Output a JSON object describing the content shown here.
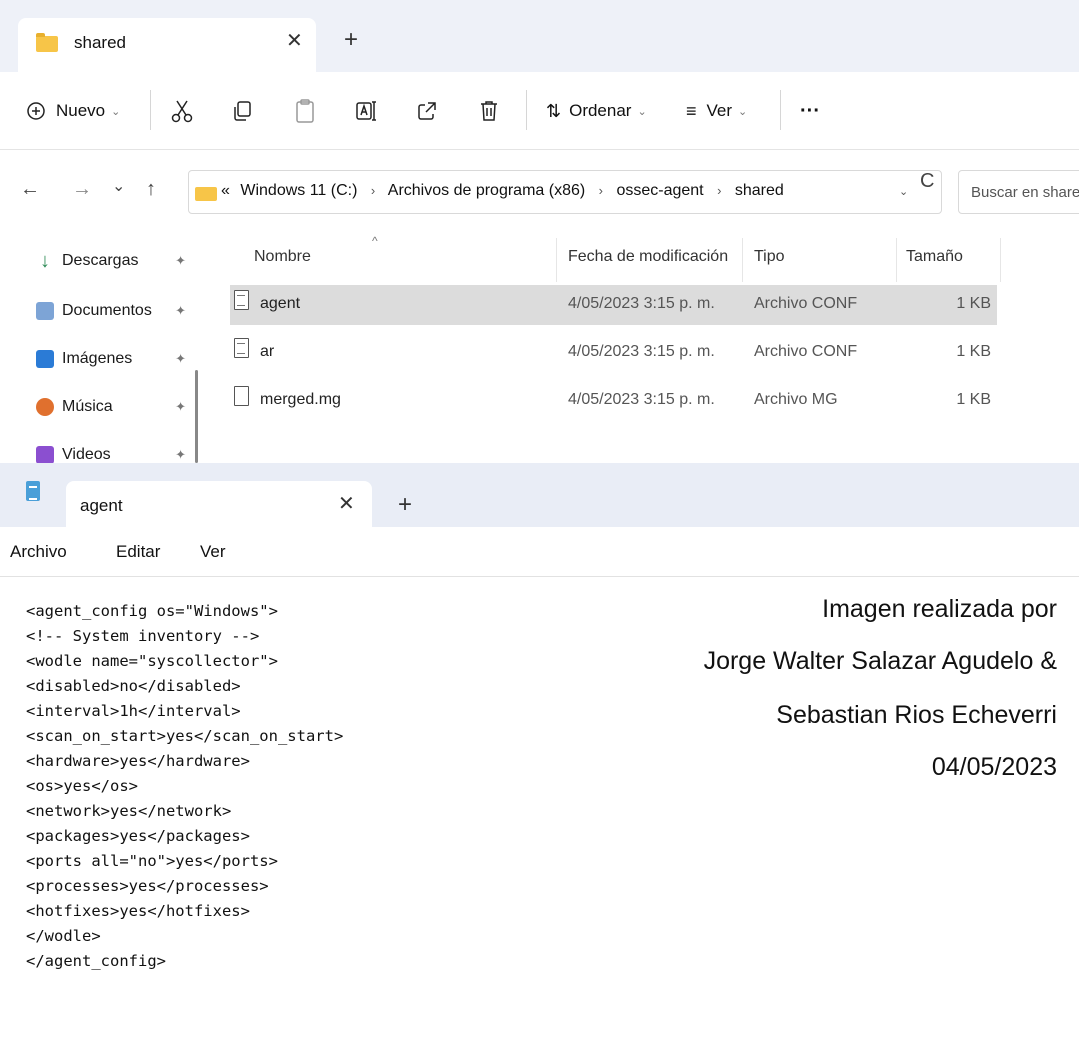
{
  "explorer": {
    "tab": {
      "title": "shared",
      "close": "✕"
    },
    "new_tab": "+",
    "toolbar": {
      "new_label": "Nuevo",
      "sort_label": "Ordenar",
      "view_label": "Ver",
      "more": "···"
    },
    "nav": {
      "back": "←",
      "forward": "→",
      "recent": "⌄",
      "up": "↑",
      "refresh": "C"
    },
    "address": {
      "overflow": "«",
      "crumbs": [
        "Windows 11 (C:)",
        "Archivos de programa (x86)",
        "ossec-agent",
        "shared"
      ],
      "separator": "›"
    },
    "search": {
      "placeholder": "Buscar en shared"
    },
    "sidebar": {
      "items": [
        {
          "label": "Descargas",
          "icon": "download-icon"
        },
        {
          "label": "Documentos",
          "icon": "documents-icon"
        },
        {
          "label": "Imágenes",
          "icon": "pictures-icon"
        },
        {
          "label": "Música",
          "icon": "music-icon"
        },
        {
          "label": "Videos",
          "icon": "videos-icon"
        }
      ],
      "pin": "📌"
    },
    "columns": {
      "name": "Nombre",
      "modified": "Fecha de modificación",
      "type": "Tipo",
      "size": "Tamaño"
    },
    "files": [
      {
        "name": "agent",
        "modified": "4/05/2023 3:15 p. m.",
        "type": "Archivo CONF",
        "size": "1 KB",
        "selected": true
      },
      {
        "name": "ar",
        "modified": "4/05/2023 3:15 p. m.",
        "type": "Archivo CONF",
        "size": "1 KB",
        "selected": false
      },
      {
        "name": "merged.mg",
        "modified": "4/05/2023 3:15 p. m.",
        "type": "Archivo MG",
        "size": "1 KB",
        "selected": false
      }
    ]
  },
  "notepad": {
    "tab": {
      "title": "agent",
      "close": "✕"
    },
    "new_tab": "+",
    "menu": {
      "file": "Archivo",
      "edit": "Editar",
      "view": "Ver"
    },
    "lines": [
      "<agent_config os=\"Windows\">",
      "<!-- System inventory -->",
      "<wodle name=\"syscollector\">",
      "<disabled>no</disabled>",
      "<interval>1h</interval>",
      "<scan_on_start>yes</scan_on_start>",
      "<hardware>yes</hardware>",
      "<os>yes</os>",
      "<network>yes</network>",
      "<packages>yes</packages>",
      "<ports all=\"no\">yes</ports>",
      "<processes>yes</processes>",
      "<hotfixes>yes</hotfixes>",
      "</wodle>",
      "</agent_config>"
    ],
    "credit": [
      "Imagen realizada por",
      "Jorge Walter Salazar Agudelo &",
      "Sebastian Rios Echeverri",
      "04/05/2023"
    ]
  }
}
